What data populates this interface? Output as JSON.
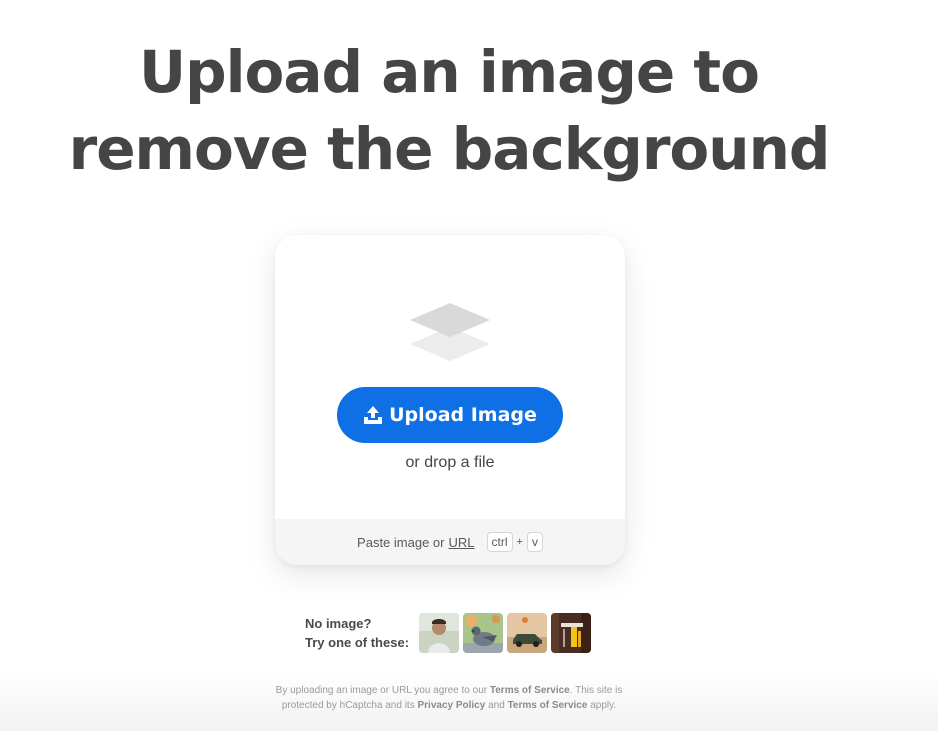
{
  "headline": {
    "line1": "Upload an image to",
    "line2": "remove the background"
  },
  "upload_card": {
    "icon": "layers-icon",
    "button_icon": "upload-icon",
    "button_label": "Upload Image",
    "drop_text": "or drop a file",
    "paste": {
      "prefix": "Paste image or",
      "url_link": "URL",
      "key1": "ctrl",
      "plus": "+",
      "key2": "v"
    }
  },
  "samples": {
    "label_line1": "No image?",
    "label_line2": "Try one of these:",
    "thumbnails": [
      "person-thumbnail",
      "pigeon-thumbnail",
      "car-thumbnail",
      "object-thumbnail"
    ]
  },
  "legal": {
    "line1_prefix": "By uploading an image or URL you agree to our",
    "terms1": "Terms of Service",
    "line1_suffix": ". This site is",
    "line2_prefix": "protected by hCaptcha and its",
    "privacy": "Privacy Policy",
    "and": "and",
    "terms2": "Terms of Service",
    "line2_suffix": "apply."
  },
  "colors": {
    "primary_button": "#0f70e6",
    "headline_text": "#454545",
    "paste_bar_bg": "#f5f5f5"
  }
}
